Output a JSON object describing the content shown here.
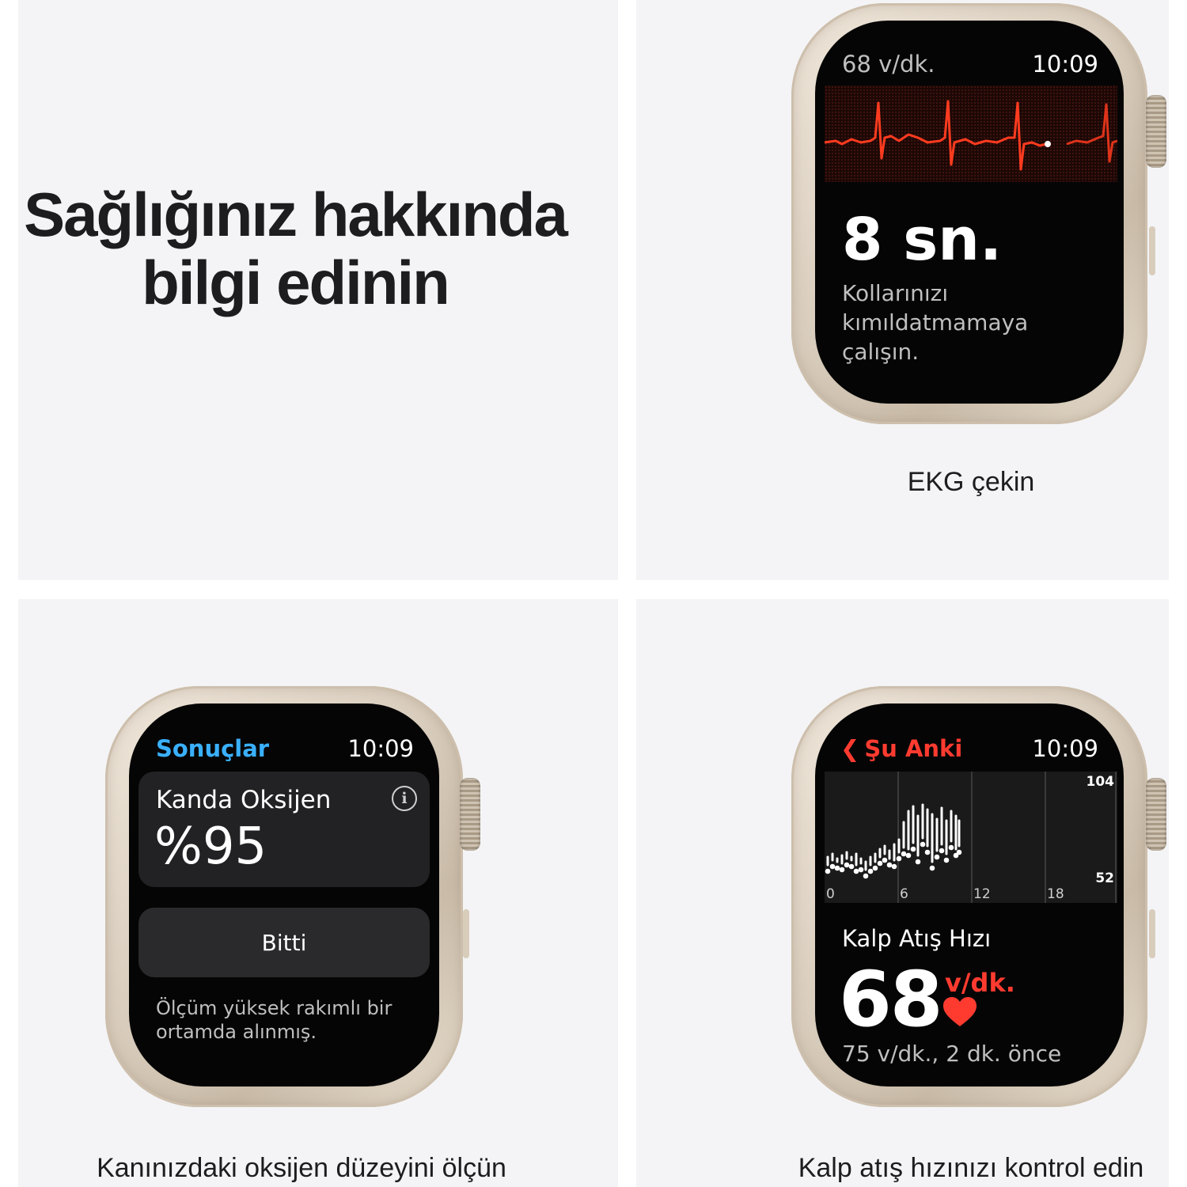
{
  "headline": {
    "line1": "Sağlığınız hakkında",
    "line2": "bilgi edinin"
  },
  "ekg": {
    "caption": "EKG çekin",
    "rate": "68 v/dk.",
    "time": "10:09",
    "count": "8 sn.",
    "instruction": [
      "Kollarınızı",
      "kımıldatmamaya",
      "çalışın."
    ],
    "color": "#ff3b1f"
  },
  "oxygen": {
    "caption": "Kanınızdaki oksijen düzeyini ölçün",
    "back_label": "Sonuçlar",
    "time": "10:09",
    "title": "Kanda Oksijen",
    "value": "%95",
    "done_label": "Bitti",
    "note": [
      "Ölçüm yüksek rakımlı bir",
      "ortamda alınmış."
    ],
    "icon": "info-icon",
    "accent": "#3ab0ff"
  },
  "heart": {
    "caption": "Kalp atış hızınızı kontrol edin",
    "back_label": "Şu Anki",
    "time": "10:09",
    "y_max": "104",
    "y_min": "52",
    "x_ticks": [
      "0",
      "6",
      "12",
      "18"
    ],
    "title": "Kalp Atış Hızı",
    "value": "68",
    "unit": "v/dk.",
    "sub": "75 v/dk., 2 dk. önce",
    "icon": "heart-icon",
    "accent": "#ff3b30"
  }
}
